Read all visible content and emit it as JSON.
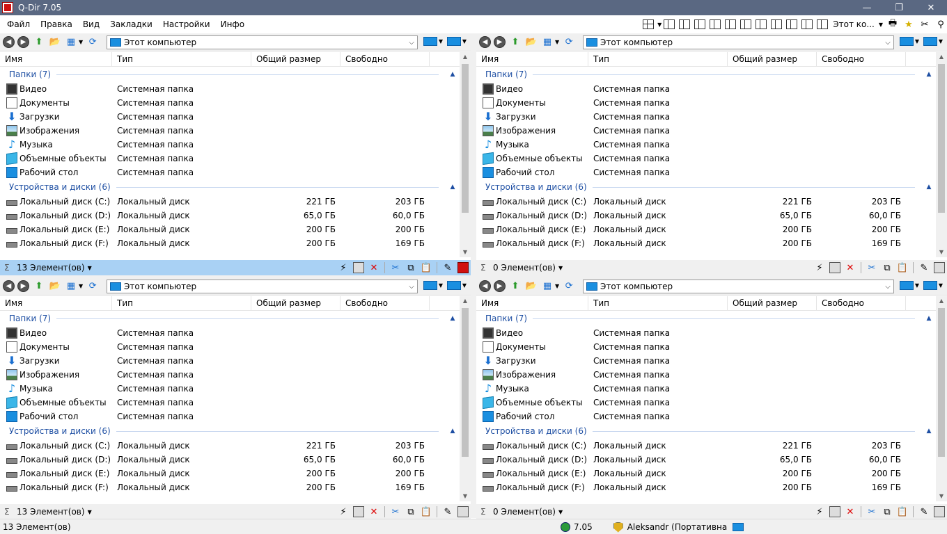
{
  "app": {
    "title": "Q-Dir 7.05"
  },
  "menu": [
    "Файл",
    "Правка",
    "Вид",
    "Закладки",
    "Настройки",
    "Инфо"
  ],
  "toolbar": {
    "location_label": "Этот ко..."
  },
  "columns": {
    "name": "Имя",
    "type": "Тип",
    "size": "Общий размер",
    "free": "Свободно"
  },
  "groups": {
    "folders": "Папки (7)",
    "devices": "Устройства и диски (6)"
  },
  "folders": [
    {
      "name": "Видео",
      "type": "Системная папка",
      "icon": "video-folder-icon"
    },
    {
      "name": "Документы",
      "type": "Системная папка",
      "icon": "documents-folder-icon"
    },
    {
      "name": "Загрузки",
      "type": "Системная папка",
      "icon": "downloads-folder-icon"
    },
    {
      "name": "Изображения",
      "type": "Системная папка",
      "icon": "pictures-folder-icon"
    },
    {
      "name": "Музыка",
      "type": "Системная папка",
      "icon": "music-folder-icon"
    },
    {
      "name": "Объемные объекты",
      "type": "Системная папка",
      "icon": "3d-objects-folder-icon"
    },
    {
      "name": "Рабочий стол",
      "type": "Системная папка",
      "icon": "desktop-folder-icon"
    }
  ],
  "drives": [
    {
      "name": "Локальный диск (C:)",
      "type": "Локальный диск",
      "size": "221 ГБ",
      "free": "203 ГБ"
    },
    {
      "name": "Локальный диск (D:)",
      "type": "Локальный диск",
      "size": "65,0 ГБ",
      "free": "60,0 ГБ"
    },
    {
      "name": "Локальный диск (E:)",
      "type": "Локальный диск",
      "size": "200 ГБ",
      "free": "200 ГБ"
    },
    {
      "name": "Локальный диск (F:)",
      "type": "Локальный диск",
      "size": "200 ГБ",
      "free": "169 ГБ"
    }
  ],
  "panes": [
    {
      "path": "Этот компьютер",
      "status": "13 Элемент(ов)",
      "active": true
    },
    {
      "path": "Этот компьютер",
      "status": "0 Элемент(ов)",
      "active": false
    },
    {
      "path": "Этот компьютер",
      "status": "13 Элемент(ов)",
      "active": false
    },
    {
      "path": "Этот компьютер",
      "status": "0 Элемент(ов)",
      "active": false
    }
  ],
  "bottom": {
    "count": "13 Элемент(ов)",
    "version": "7.05",
    "user": "Aleksandr (Портативна"
  },
  "colors": {
    "titlebar": "#5a6882",
    "active_status": "#a9d1f4",
    "group_text": "#1e4fa3"
  }
}
